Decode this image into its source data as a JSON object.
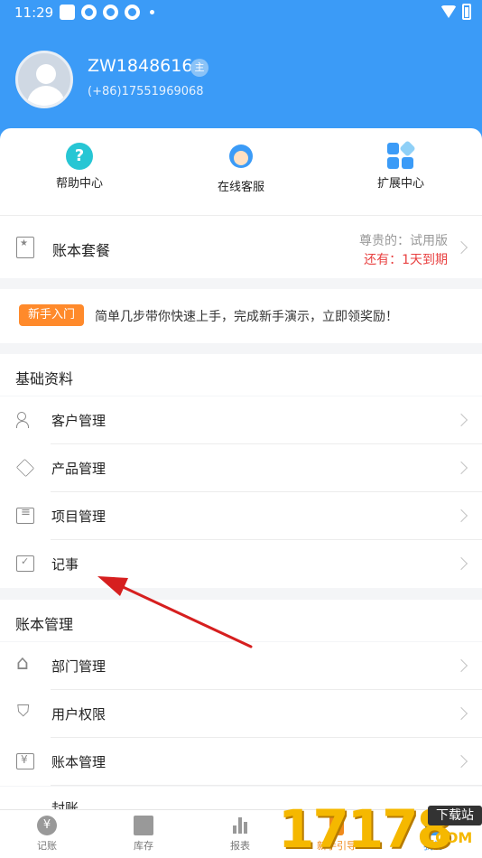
{
  "status_bar": {
    "time": "11:29"
  },
  "user": {
    "name": "ZW1848616",
    "role_badge": "主",
    "phone": "(+86)17551969068"
  },
  "quick_actions": [
    {
      "label": "帮助中心",
      "icon": "help-icon",
      "icon_glyph": "?"
    },
    {
      "label": "在线客服",
      "icon": "customer-service-icon"
    },
    {
      "label": "扩展中心",
      "icon": "extensions-icon"
    }
  ],
  "plan": {
    "title": "账本套餐",
    "level": "尊贵的：试用版",
    "expire": "还有：1天到期"
  },
  "guide": {
    "badge": "新手入门",
    "text": "简单几步带你快速上手，完成新手演示，立即领奖励！"
  },
  "sections": {
    "basic": {
      "title": "基础资料",
      "items": [
        {
          "label": "客户管理",
          "icon": "customers-icon"
        },
        {
          "label": "产品管理",
          "icon": "product-box-icon"
        },
        {
          "label": "项目管理",
          "icon": "project-list-icon"
        },
        {
          "label": "记事",
          "icon": "notes-icon"
        }
      ]
    },
    "ledger": {
      "title": "账本管理",
      "items": [
        {
          "label": "部门管理",
          "icon": "department-home-icon"
        },
        {
          "label": "用户权限",
          "icon": "permission-shield-icon"
        },
        {
          "label": "账本管理",
          "icon": "ledger-yen-icon"
        }
      ],
      "partial_item": "封账"
    }
  },
  "tabbar": [
    {
      "label": "记账",
      "glyph": "¥"
    },
    {
      "label": "库存"
    },
    {
      "label": "报表"
    },
    {
      "label": "新手引导"
    },
    {
      "label": "我的"
    }
  ],
  "watermark": {
    "number": "17178",
    "tag": "下载站",
    "domain": ".COM"
  },
  "colors": {
    "primary": "#3b9bf7",
    "accent_orange": "#ff8a2b",
    "danger": "#e84040",
    "arrow": "#d61f1f"
  }
}
